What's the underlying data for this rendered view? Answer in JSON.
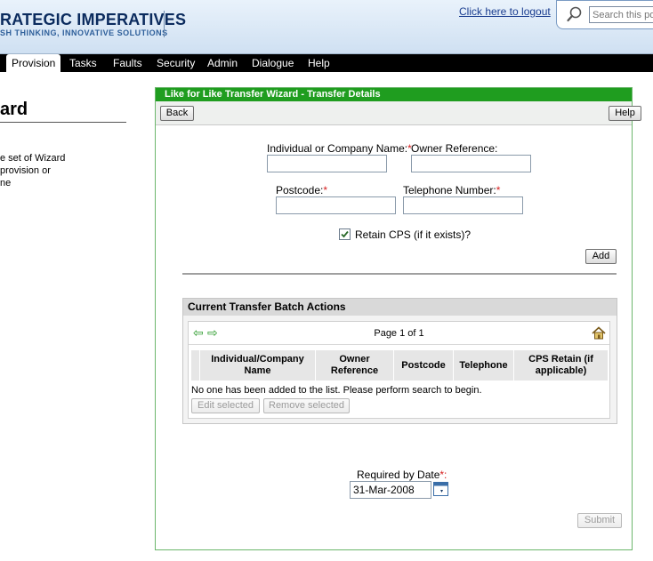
{
  "header": {
    "brand_title": "RATEGIC IMPERATIVES",
    "brand_subtitle": "SH THINKING, INNOVATIVE SOLUTIONS",
    "logout_link": "Click here to logout",
    "search_placeholder": "Search this port"
  },
  "nav": {
    "items": [
      {
        "label": "Provision",
        "active": true
      },
      {
        "label": "Tasks"
      },
      {
        "label": "Faults"
      },
      {
        "label": "Security"
      },
      {
        "label": "Admin"
      },
      {
        "label": "Dialogue"
      },
      {
        "label": "Help"
      }
    ]
  },
  "left": {
    "title": "ard",
    "description_lines": [
      "e set of Wizard",
      "provision or",
      "ne"
    ]
  },
  "wizard": {
    "title": "Like for Like Transfer Wizard - Transfer Details",
    "back_label": "Back",
    "help_label": "Help",
    "form": {
      "name_label": "Individual or Company Name:",
      "owner_ref_label": "Owner Reference:",
      "postcode_label": "Postcode:",
      "telephone_label": "Telephone Number:",
      "required_marker": "*",
      "name_value": "",
      "owner_ref_value": "",
      "postcode_value": "",
      "telephone_value": "",
      "retain_cps_label": "Retain CPS (if it exists)?",
      "retain_cps_checked": true,
      "add_label": "Add"
    },
    "batch": {
      "title": "Current Transfer Batch Actions",
      "page_text": "Page 1 of 1",
      "columns": [
        "Individual/Company Name",
        "Owner Reference",
        "Postcode",
        "Telephone",
        "CPS Retain (if applicable)"
      ],
      "empty_message": "No one has been added to the list. Please perform search to begin.",
      "edit_label": "Edit selected",
      "remove_label": "Remove selected"
    },
    "required_date_label": "Required by Date",
    "required_date_value": "31-Mar-2008",
    "submit_label": "Submit"
  },
  "colors": {
    "wizard_title_bg": "#1f9d1f",
    "nav_bg": "#000000",
    "required_marker": "#d62020",
    "nav_arrow": "#2a9a2a"
  }
}
